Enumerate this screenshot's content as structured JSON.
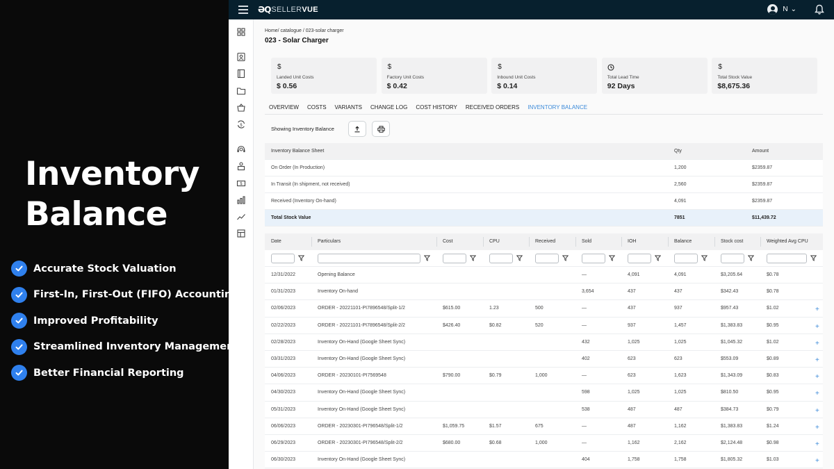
{
  "promo": {
    "title_line1": "Inventory",
    "title_line2": "Balance",
    "features": [
      "Accurate Stock Valuation",
      "First-In, First-Out (FIFO) Accounting",
      "Improved Profitability",
      "Streamlined Inventory Management",
      "Better Financial Reporting"
    ]
  },
  "topbar": {
    "logo_mark": "ƏQ",
    "logo_seller": "SELLER",
    "logo_vue": "VUE",
    "user_initial": "N",
    "user_caret": "⌄"
  },
  "breadcrumb": "Home/ catalogue  / 023-solar charger",
  "page_title": "023 - Solar Charger",
  "cards": [
    {
      "icon": "$",
      "label": "Landed Unit Costs",
      "value": "$ 0.56"
    },
    {
      "icon": "$",
      "label": "Factory Unit Costs",
      "value": "$ 0.42"
    },
    {
      "icon": "$",
      "label": "Inbound Unit Costs",
      "value": "$ 0.14"
    },
    {
      "icon": "clock-icon",
      "label": "Total Lead Time",
      "value": "92 Days"
    },
    {
      "icon": "$",
      "label": "Total Stock Value",
      "value": "$8,675.36"
    }
  ],
  "tabs": [
    "OVERVIEW",
    "COSTS",
    "VARIANTS",
    "CHANGE LOG",
    "COST HISTORY",
    "RECEIVED ORDERS",
    "INVENTORY BALANCE"
  ],
  "toolbar": {
    "label": "Showing Inventory Balance"
  },
  "balance_sheet": {
    "headers": [
      "Inventory Balance Sheet",
      "Qty",
      "Amount"
    ],
    "rows": [
      [
        "On Order (In Production)",
        "1,200",
        "$2359.87"
      ],
      [
        "In Transit (In shipment, not received)",
        "2,560",
        "$2359.87"
      ],
      [
        "Received (Inventory On-hand)",
        "4,091",
        "$2359.87"
      ]
    ],
    "total": [
      "Total Stock Value",
      "7851",
      "$11,439.72"
    ]
  },
  "ledger": {
    "headers": [
      "Date",
      "Particulars",
      "Cost",
      "CPU",
      "Received",
      "Sold",
      "IOH",
      "Balance",
      "Stock cost",
      "Weighted Avg CPU"
    ],
    "rows": [
      [
        "12/31/2022",
        "Opening Balance",
        "",
        "",
        "",
        "—",
        "4,091",
        "4,091",
        "$3,205.64",
        "$0.78",
        ""
      ],
      [
        "01/31/2023",
        "Inventory On-hand",
        "",
        "",
        "",
        "3,654",
        "437",
        "437",
        "$342.43",
        "$0.78",
        ""
      ],
      [
        "02/06/2023",
        "ORDER - 20221101-PI7896548/Split-1/2",
        "$615.00",
        "1.23",
        "500",
        "—",
        "437",
        "937",
        "$957.43",
        "$1.02",
        "+"
      ],
      [
        "02/22/2023",
        "ORDER - 20221101-PI7896548/Split-2/2",
        "$426.40",
        "$0.82",
        "520",
        "—",
        "937",
        "1,457",
        "$1,383.83",
        "$0.95",
        "+"
      ],
      [
        "02/28/2023",
        "Inventory On-Hand (Google Sheet Sync)",
        "",
        "",
        "",
        "432",
        "1,025",
        "1,025",
        "$1,045.32",
        "$1.02",
        "+"
      ],
      [
        "03/31/2023",
        "Inventory On-Hand (Google Sheet Sync)",
        "",
        "",
        "",
        "402",
        "623",
        "623",
        "$553.09",
        "$0.89",
        "+"
      ],
      [
        "04/06/2023",
        "ORDER - 20230101-PI7569548",
        "$790.00",
        "$0.79",
        "1,000",
        "—",
        "623",
        "1,623",
        "$1,343.09",
        "$0.83",
        "+"
      ],
      [
        "04/30/2023",
        "Inventory On-Hand (Google Sheet Sync)",
        "",
        "",
        "",
        "598",
        "1,025",
        "1,025",
        "$810.50",
        "$0.95",
        "+"
      ],
      [
        "05/31/2023",
        "Inventory On-Hand (Google Sheet Sync)",
        "",
        "",
        "",
        "538",
        "487",
        "487",
        "$384.73",
        "$0.79",
        "+"
      ],
      [
        "06/06/2023",
        "ORDER - 20230301-PI796548/Split-1/2",
        "$1,059.75",
        "$1.57",
        "675",
        "—",
        "487",
        "1,162",
        "$1,383.83",
        "$1.24",
        "+"
      ],
      [
        "06/29/2023",
        "ORDER - 20230301-PI796548/Split-2/2",
        "$680.00",
        "$0.68",
        "1,000",
        "—",
        "1,162",
        "2,162",
        "$2,124.48",
        "$0.98",
        "+"
      ],
      [
        "06/30/2023",
        "Inventory On-Hand (Google Sheet Sync)",
        "",
        "",
        "",
        "404",
        "1,758",
        "1,758",
        "$1,805.32",
        "$1.03",
        "+"
      ]
    ]
  },
  "colors": {
    "accent": "#3b8ad9",
    "topbar": "#07202e",
    "check": "#2f80ed"
  }
}
